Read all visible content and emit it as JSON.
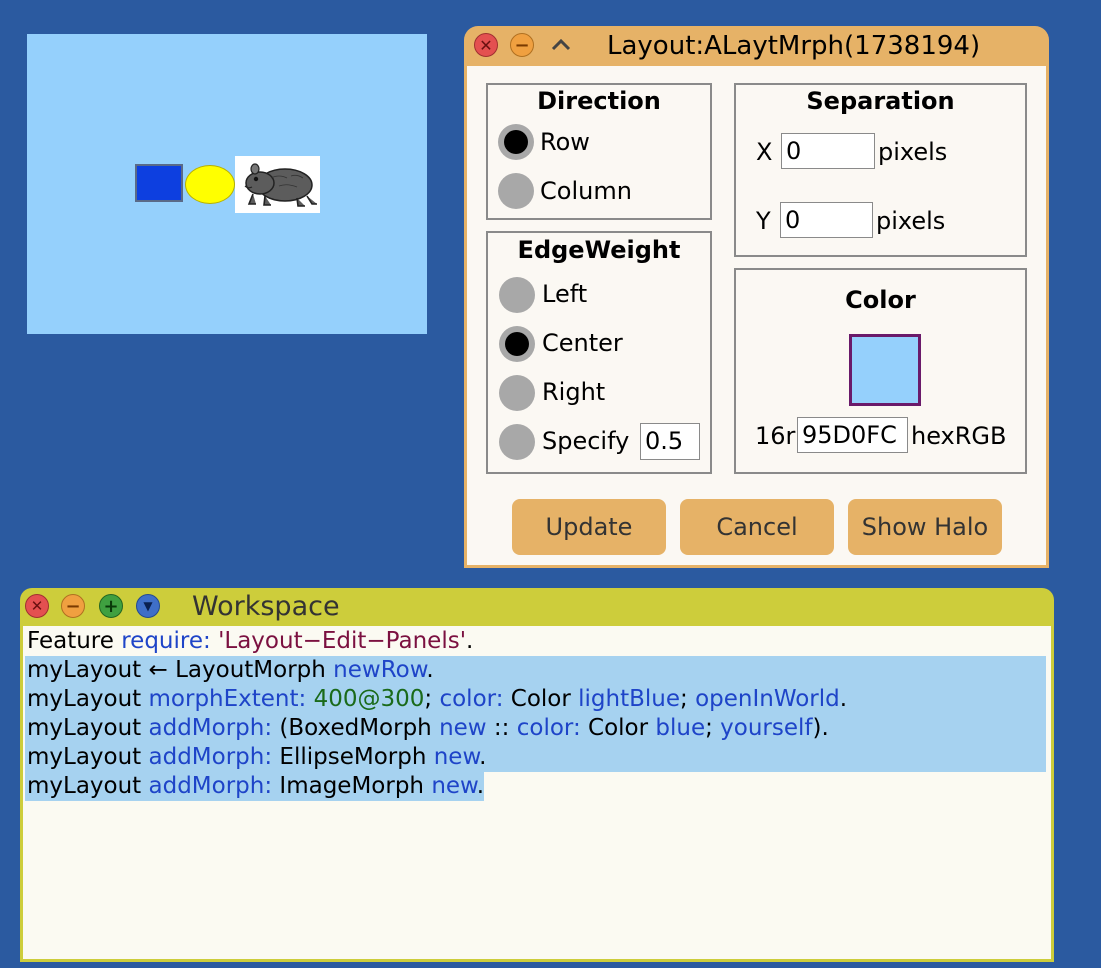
{
  "layout_morph": {
    "color": "#95D0FC",
    "boxed_color": "#0D3FE0",
    "ellipse_color": "#FFFF00",
    "image_icon": "rodent-icon"
  },
  "edit_window": {
    "title": "Layout:ALaytMrph(1738194)",
    "controls": [
      "close-icon",
      "minimize-icon",
      "collapse-icon"
    ],
    "direction": {
      "title": "Direction",
      "options": [
        "Row",
        "Column"
      ],
      "selected": "Row"
    },
    "separation": {
      "title": "Separation",
      "x_label": "X",
      "x_value": "0",
      "y_label": "Y",
      "y_value": "0",
      "unit": "pixels"
    },
    "edge_weight": {
      "title": "EdgeWeight",
      "options": [
        "Left",
        "Center",
        "Right",
        "Specify"
      ],
      "selected": "Center",
      "specify_value": "0.5"
    },
    "color": {
      "title": "Color",
      "swatch": "#95D0FC",
      "prefix": "16r",
      "hex_value": "95D0FC",
      "suffix": "hexRGB"
    },
    "buttons": {
      "update": "Update",
      "cancel": "Cancel",
      "show_halo": "Show Halo"
    }
  },
  "workspace": {
    "title": "Workspace",
    "controls": [
      "close-icon",
      "minimize-icon",
      "expand-icon",
      "menu-icon"
    ],
    "lines": [
      [
        {
          "t": "Feature ",
          "c": "p"
        },
        {
          "t": "require:",
          "c": "k"
        },
        {
          "t": " ",
          "c": "p"
        },
        {
          "t": "'Layout−Edit−Panels'",
          "c": "s"
        },
        {
          "t": ".",
          "c": "p"
        }
      ],
      [
        {
          "t": "myLayout ← LayoutMorph ",
          "c": "p"
        },
        {
          "t": "newRow",
          "c": "k"
        },
        {
          "t": ".",
          "c": "p"
        }
      ],
      [
        {
          "t": "myLayout ",
          "c": "p"
        },
        {
          "t": "morphExtent:",
          "c": "k"
        },
        {
          "t": " ",
          "c": "p"
        },
        {
          "t": "400@300",
          "c": "n"
        },
        {
          "t": "; ",
          "c": "p"
        },
        {
          "t": "color:",
          "c": "k"
        },
        {
          "t": " Color ",
          "c": "p"
        },
        {
          "t": "lightBlue",
          "c": "k"
        },
        {
          "t": "; ",
          "c": "p"
        },
        {
          "t": "openInWorld",
          "c": "k"
        },
        {
          "t": ".",
          "c": "p"
        }
      ],
      [
        {
          "t": "myLayout ",
          "c": "p"
        },
        {
          "t": "addMorph:",
          "c": "k"
        },
        {
          "t": " (BoxedMorph ",
          "c": "p"
        },
        {
          "t": "new",
          "c": "k"
        },
        {
          "t": " :: ",
          "c": "p"
        },
        {
          "t": "color:",
          "c": "k"
        },
        {
          "t": " Color ",
          "c": "p"
        },
        {
          "t": "blue",
          "c": "k"
        },
        {
          "t": "; ",
          "c": "p"
        },
        {
          "t": "yourself",
          "c": "k"
        },
        {
          "t": ").",
          "c": "p"
        }
      ],
      [
        {
          "t": "myLayout ",
          "c": "p"
        },
        {
          "t": "addMorph:",
          "c": "k"
        },
        {
          "t": " EllipseMorph ",
          "c": "p"
        },
        {
          "t": "new",
          "c": "k"
        },
        {
          "t": ".",
          "c": "p"
        }
      ],
      [
        {
          "t": "myLayout ",
          "c": "p"
        },
        {
          "t": "addMorph:",
          "c": "k"
        },
        {
          "t": " ImageMorph ",
          "c": "p"
        },
        {
          "t": "new",
          "c": "k"
        },
        {
          "t": ".",
          "c": "p"
        }
      ]
    ],
    "selected_lines": [
      1,
      2,
      3,
      4,
      5
    ]
  }
}
